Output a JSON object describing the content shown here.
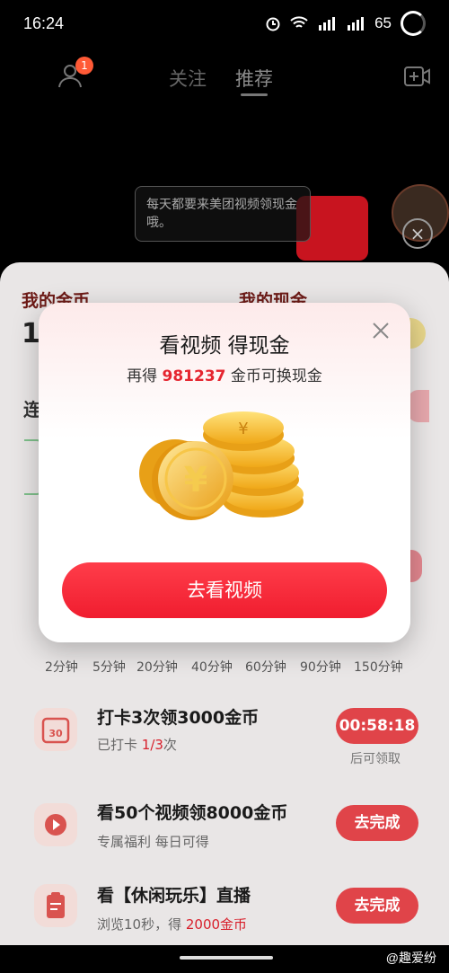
{
  "status_bar": {
    "time": "16:24",
    "battery": "65",
    "net1": "5G",
    "net2": "4G"
  },
  "top_nav": {
    "follow_tab": "关注",
    "recommend_tab": "推荐",
    "notification_count": "1"
  },
  "video": {
    "bubble_text": "每天都要来美团视频领现金哦。"
  },
  "sheet": {
    "my_coins_label": "我的金币",
    "my_cash_label": "我的现金",
    "coins_value_partial": "1",
    "streak_label_partial": "连"
  },
  "timeline": [
    "2分钟",
    "5分钟",
    "20分钟",
    "40分钟",
    "60分钟",
    "90分钟",
    "150分钟"
  ],
  "tasks": [
    {
      "title": "打卡3次领3000金币",
      "sub_prefix": "已打卡 ",
      "sub_highlight": "1/3",
      "sub_suffix": "次",
      "button": "00:58:18",
      "note": "后可领取"
    },
    {
      "title": "看50个视频领8000金币",
      "sub": "专属福利 每日可得",
      "button": "去完成"
    },
    {
      "title": "看【休闲玩乐】直播",
      "sub_prefix": "浏览10秒，得 ",
      "sub_highlight": "2000金币",
      "button": "去完成"
    }
  ],
  "modal": {
    "title": "看视频 得现金",
    "subtitle_prefix": "再得 ",
    "subtitle_number": "981237",
    "subtitle_suffix": " 金币可换现金",
    "cta": "去看视频"
  },
  "watermark": "@趣爱纷",
  "colors": {
    "accent_red": "#f01d2f",
    "highlight_red": "#e5252f"
  }
}
